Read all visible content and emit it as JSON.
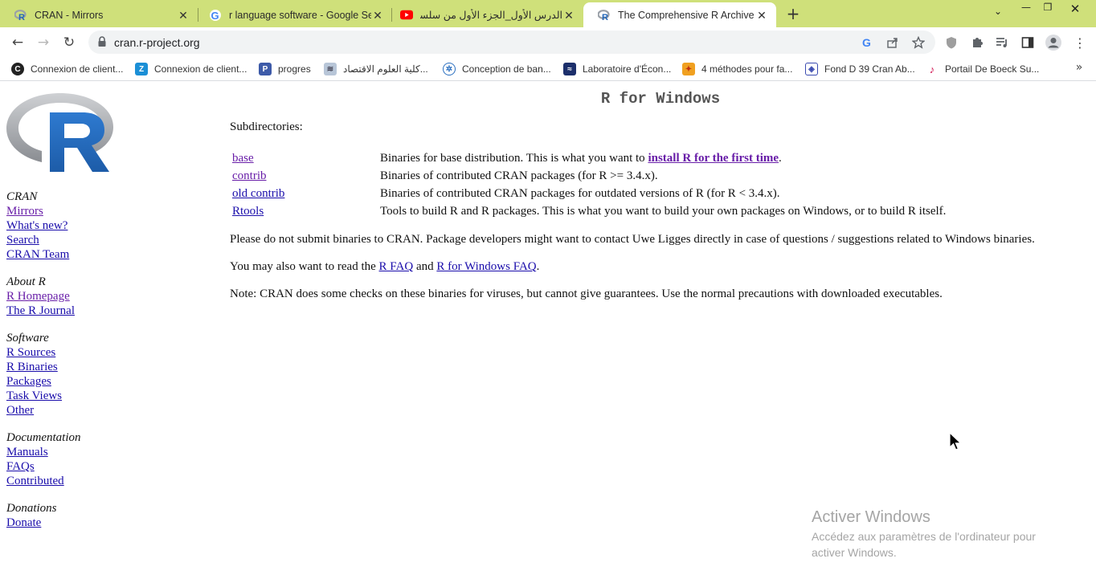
{
  "browser": {
    "tabs": [
      {
        "title": "CRAN - Mirrors",
        "favicon": "r-logo-icon",
        "active": false
      },
      {
        "title": "r language software - Google Se",
        "favicon": "google-icon",
        "active": false
      },
      {
        "title": "الدرس الأول_الجزء الأول من سلسلة_",
        "favicon": "youtube-icon",
        "active": false
      },
      {
        "title": "The Comprehensive R Archive Ne",
        "favicon": "r-logo-icon",
        "active": true
      }
    ],
    "url": "cran.r-project.org",
    "bookmarks": [
      {
        "label": "Connexion de client...",
        "icon": "c-icon"
      },
      {
        "label": "Connexion de client...",
        "icon": "z-icon"
      },
      {
        "label": "progres",
        "icon": "p-icon"
      },
      {
        "label": "كلية العلوم الاقتصاد...",
        "icon": "faculty-icon"
      },
      {
        "label": "Conception de ban...",
        "icon": "bee-icon"
      },
      {
        "label": "Laboratoire d'Écon...",
        "icon": "lab-icon"
      },
      {
        "label": "4 méthodes pour fa...",
        "icon": "bird-icon"
      },
      {
        "label": "Fond D 39 Cran Ab...",
        "icon": "shield-icon"
      },
      {
        "label": "Portail De Boeck Su...",
        "icon": "tiktok-icon"
      }
    ]
  },
  "sidebar": {
    "sections": [
      {
        "title": "CRAN",
        "links": [
          {
            "label": "Mirrors",
            "visited": true
          },
          {
            "label": "What's new?",
            "visited": false
          },
          {
            "label": "Search",
            "visited": false
          },
          {
            "label": "CRAN Team",
            "visited": false
          }
        ]
      },
      {
        "title": "About R",
        "links": [
          {
            "label": "R Homepage",
            "visited": true
          },
          {
            "label": "The R Journal",
            "visited": false
          }
        ]
      },
      {
        "title": "Software",
        "links": [
          {
            "label": "R Sources",
            "visited": false
          },
          {
            "label": "R Binaries",
            "visited": false
          },
          {
            "label": "Packages",
            "visited": false
          },
          {
            "label": "Task Views",
            "visited": false
          },
          {
            "label": "Other",
            "visited": false
          }
        ]
      },
      {
        "title": "Documentation",
        "links": [
          {
            "label": "Manuals",
            "visited": false
          },
          {
            "label": "FAQs",
            "visited": false
          },
          {
            "label": "Contributed",
            "visited": false
          }
        ]
      },
      {
        "title": "Donations",
        "links": [
          {
            "label": "Donate",
            "visited": false
          }
        ]
      }
    ]
  },
  "main": {
    "heading": "R for Windows",
    "subdirectories_label": "Subdirectories:",
    "directories": [
      {
        "name": "base",
        "visited": true,
        "desc_prefix": "Binaries for base distribution. This is what you want to ",
        "desc_link": "install R for the first time",
        "desc_suffix": "."
      },
      {
        "name": "contrib",
        "visited": true,
        "desc_prefix": "Binaries of contributed CRAN packages (for R >= 3.4.x).",
        "desc_link": "",
        "desc_suffix": ""
      },
      {
        "name": "old contrib",
        "visited": false,
        "desc_prefix": "Binaries of contributed CRAN packages for outdated versions of R (for R < 3.4.x).",
        "desc_link": "",
        "desc_suffix": ""
      },
      {
        "name": "Rtools",
        "visited": false,
        "desc_prefix": "Tools to build R and R packages. This is what you want to build your own packages on Windows, or to build R itself.",
        "desc_link": "",
        "desc_suffix": ""
      }
    ],
    "para1": "Please do not submit binaries to CRAN. Package developers might want to contact Uwe Ligges directly in case of questions / suggestions related to Windows binaries.",
    "para2": {
      "prefix": "You may also want to read the ",
      "link1": "R FAQ",
      "middle": " and ",
      "link2": "R for Windows FAQ",
      "suffix": "."
    },
    "para3": "Note: CRAN does some checks on these binaries for viruses, but cannot give guarantees. Use the normal precautions with downloaded executables."
  },
  "watermark": {
    "title": "Activer Windows",
    "subtitle": "Accédez aux paramètres de l'ordinateur pour activer Windows."
  }
}
